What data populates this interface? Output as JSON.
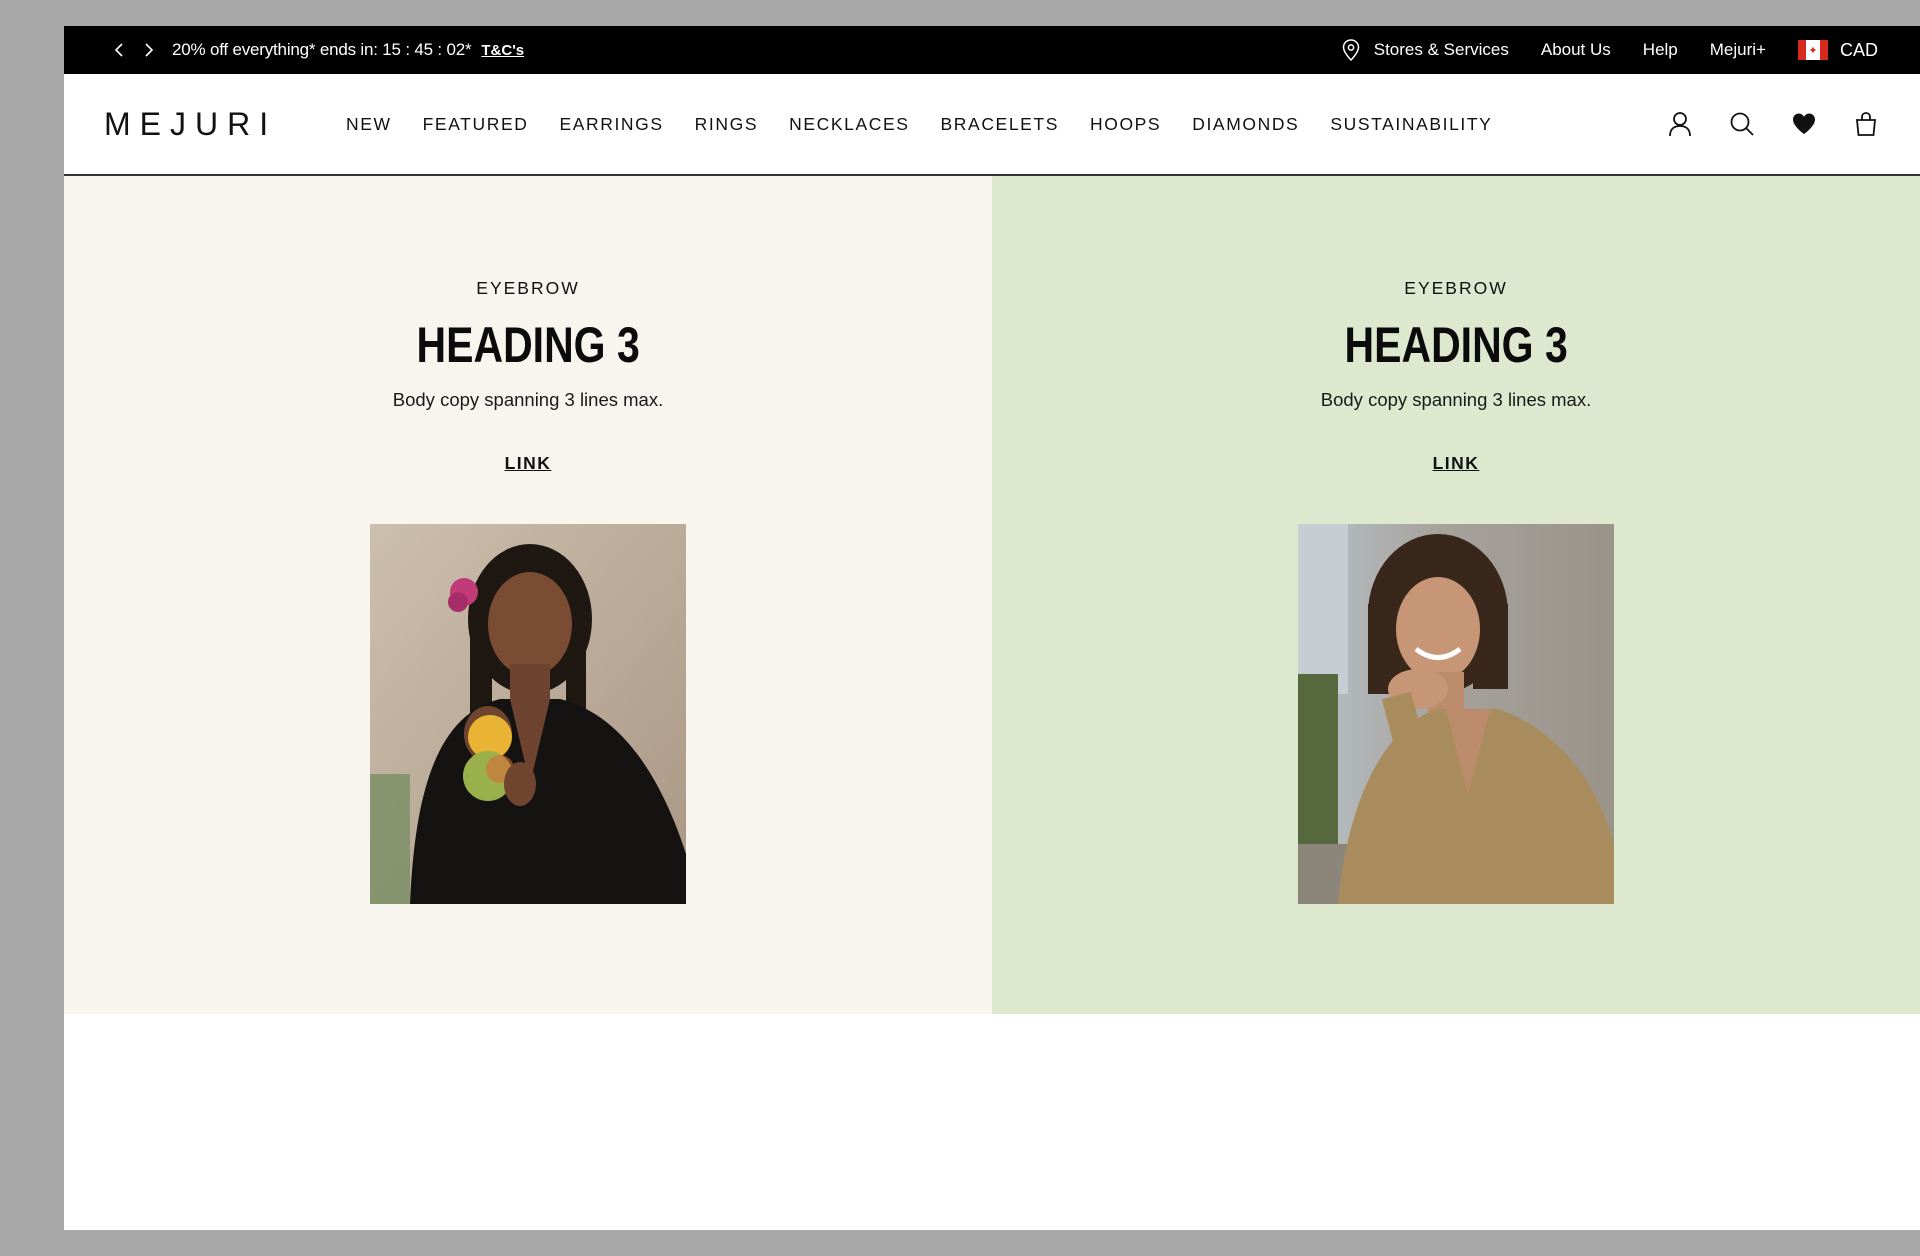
{
  "promo": {
    "prev_icon": "chevron-left-icon",
    "next_icon": "chevron-right-icon",
    "text": "20% off everything* ends in: 15 : 45 : 02*",
    "terms_link": "T&C's",
    "links": {
      "stores": "Stores & Services",
      "about": "About Us",
      "help": "Help",
      "plus": "Mejuri+"
    },
    "currency": "CAD",
    "flag_icon": "canada-flag-icon"
  },
  "header": {
    "logo": "MEJURI",
    "nav": [
      "NEW",
      "FEATURED",
      "EARRINGS",
      "RINGS",
      "NECKLACES",
      "BRACELETS",
      "HOOPS",
      "DIAMONDS",
      "SUSTAINABILITY"
    ],
    "icons": [
      "account-icon",
      "search-icon",
      "heart-icon",
      "bag-icon"
    ]
  },
  "panels": [
    {
      "eyebrow": "EYEBROW",
      "heading": "HEADING 3",
      "body": "Body copy spanning 3 lines max.",
      "link": "LINK",
      "background": "#f8f5ee"
    },
    {
      "eyebrow": "EYEBROW",
      "heading": "HEADING 3",
      "body": "Body copy spanning 3 lines max.",
      "link": "LINK",
      "background": "#dde8cf"
    }
  ],
  "colors": {
    "promo_bg": "#000000",
    "cream_panel": "#f8f5ee",
    "green_panel": "#dde8cf"
  }
}
